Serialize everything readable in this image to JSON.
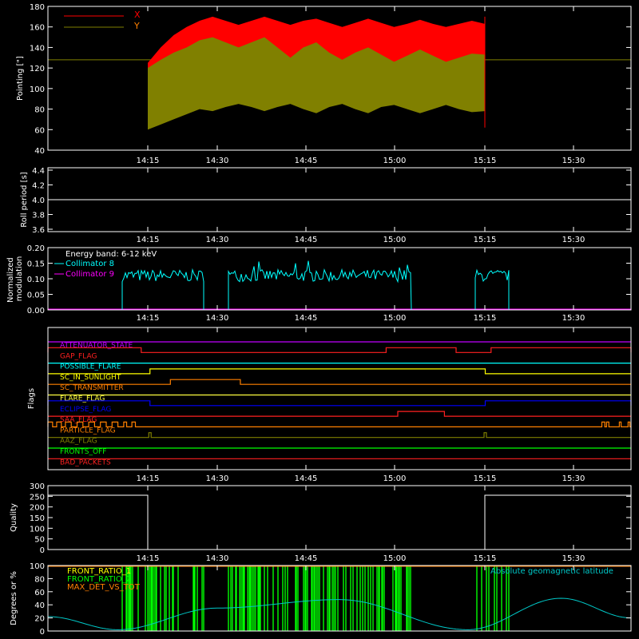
{
  "colors": {
    "background": "#000000",
    "axes": "#ffffff",
    "x_pointing": "#ff0000",
    "y_pointing": "#808000",
    "collimator_8": "#00ffff",
    "collimator_9": "#ff00ff",
    "quality": "#ffffff",
    "front_ratio_1": "#ffff00",
    "front_ratio_2": "#00ff00",
    "max_det_vs_tot": "#ff8000",
    "geomag_latitude": "#00c8c8"
  },
  "time_ticks": [
    "14:15",
    "14:30",
    "14:45",
    "15:00",
    "15:15",
    "15:30"
  ],
  "chart_data": [
    {
      "type": "area",
      "id": "pointing",
      "ylabel": "Pointing [\"]",
      "ylim": [
        40,
        180
      ],
      "yticks": [
        "40",
        "60",
        "80",
        "100",
        "120",
        "140",
        "160",
        "180"
      ],
      "xlim_minutes": [
        0,
        100
      ],
      "legend": [
        "X",
        "Y"
      ],
      "series": [
        {
          "name": "X",
          "x_start": 17.5,
          "x_end": 74.5,
          "upper": [
            125,
            140,
            152,
            160,
            166,
            170,
            166,
            162,
            166,
            170,
            166,
            162,
            166,
            168,
            164,
            160,
            164,
            168,
            164,
            160,
            163,
            167,
            163,
            160,
            163,
            166,
            163
          ],
          "lower": [
            62,
            82,
            95,
            105,
            110,
            112,
            112,
            110,
            112,
            114,
            112,
            110,
            112,
            113,
            111,
            110,
            112,
            113,
            111,
            110,
            112,
            113,
            111,
            110,
            112,
            113,
            112
          ]
        },
        {
          "name": "Y",
          "x_start": 17.5,
          "x_end": 74.5,
          "upper": [
            120,
            128,
            135,
            140,
            147,
            150,
            145,
            140,
            145,
            150,
            140,
            130,
            140,
            145,
            135,
            128,
            135,
            140,
            133,
            126,
            132,
            138,
            132,
            126,
            130,
            134,
            133
          ],
          "lower": [
            60,
            65,
            70,
            75,
            80,
            78,
            82,
            85,
            82,
            78,
            82,
            85,
            80,
            76,
            82,
            85,
            80,
            76,
            82,
            84,
            80,
            76,
            80,
            84,
            80,
            77,
            78
          ]
        }
      ],
      "baseline": 128
    },
    {
      "type": "line",
      "id": "roll_period",
      "ylabel": "Roll period [s]",
      "ylim": [
        3.5,
        4.5
      ],
      "yticks": [
        "3.6",
        "3.8",
        "4.0",
        "4.2",
        "4.4"
      ],
      "series": [
        {
          "name": "",
          "x": [
            0,
            100
          ],
          "values": [
            4.0,
            4.0
          ]
        }
      ]
    },
    {
      "type": "line",
      "id": "modulation",
      "ylabel": "Normalized modulation",
      "ylim": [
        0,
        0.2
      ],
      "yticks": [
        "0.00",
        "0.05",
        "0.10",
        "0.15",
        "0.20"
      ],
      "annotation": "Energy band: 6-12 keV",
      "legend": [
        "Collimator 8",
        "Collimator 9"
      ],
      "segments": [
        [
          16,
          29
        ],
        [
          33,
          58
        ],
        [
          70,
          76
        ]
      ],
      "level": 0.11,
      "noise": 0.012
    },
    {
      "type": "line",
      "id": "flags",
      "ylabel": "Flags",
      "flags": [
        {
          "name": "ATTENUATOR_STATE",
          "color": "#c000ff",
          "high": []
        },
        {
          "name": "GAP_FLAG",
          "color": "#ff2020",
          "high": [
            [
              0,
              16
            ],
            [
              58,
              70
            ],
            [
              76,
              100
            ]
          ]
        },
        {
          "name": "POSSIBLE_FLARE",
          "color": "#00ffff",
          "high": []
        },
        {
          "name": "SC_IN_SUNLIGHT",
          "color": "#ffff00",
          "high": [
            [
              17.5,
              75
            ]
          ]
        },
        {
          "name": "SC_TRANSMITTER",
          "color": "#ff8000",
          "high": [
            [
              21,
              33
            ]
          ]
        },
        {
          "name": "FLARE_FLAG",
          "color": "#ffff40",
          "high": []
        },
        {
          "name": "ECLIPSE_FLAG",
          "color": "#0000ff",
          "high": [
            [
              0,
              17.5
            ],
            [
              75,
              100
            ]
          ]
        },
        {
          "name": "SAA_FLAG",
          "color": "#ff2020",
          "high": [
            [
              60,
              68
            ]
          ]
        },
        {
          "name": "PARTICLE_FLAG",
          "color": "#ff8000",
          "high": [
            [
              0,
              0.8
            ],
            [
              1.5,
              2.3
            ],
            [
              3,
              4
            ],
            [
              5,
              6
            ],
            [
              7,
              8
            ],
            [
              9,
              10
            ],
            [
              11,
              12
            ],
            [
              13,
              13.5
            ],
            [
              14.4,
              15
            ],
            [
              95,
              95.5
            ],
            [
              95.8,
              96.2
            ],
            [
              98,
              98.3
            ],
            [
              99.5,
              99.8
            ]
          ]
        },
        {
          "name": "AAZ_FLAG",
          "color": "#808000",
          "high": [
            [
              17.3,
              17.7
            ],
            [
              74.8,
              75.2
            ]
          ]
        },
        {
          "name": "FRONTS_OFF",
          "color": "#00ff00",
          "high": []
        },
        {
          "name": "BAD_PACKETS",
          "color": "#ff2020",
          "high": []
        }
      ]
    },
    {
      "type": "line",
      "id": "quality",
      "ylabel": "Quality",
      "ylim": [
        0,
        300
      ],
      "yticks": [
        "0",
        "50",
        "100",
        "150",
        "200",
        "250",
        "300"
      ],
      "series": [
        {
          "name": "",
          "x": [
            0,
            17.5,
            17.5,
            75,
            75,
            100
          ],
          "values": [
            255,
            255,
            0,
            0,
            255,
            255
          ]
        }
      ]
    },
    {
      "type": "line",
      "id": "front_ratio",
      "ylabel": "Degrees or %",
      "ylim": [
        0,
        100
      ],
      "yticks": [
        "0",
        "20",
        "40",
        "60",
        "80",
        "100"
      ],
      "legend": [
        "FRONT_RATIO_1",
        "FRONT_RATIO_2",
        "MAX_DET_VS_TOT"
      ],
      "annotation": "Absolute geomagnetic latitude",
      "bar_segments": [
        [
          16,
          29
        ],
        [
          33,
          58
        ],
        [
          70,
          76
        ]
      ],
      "latitude": {
        "x": [
          0,
          12,
          29,
          50,
          72,
          88,
          100
        ],
        "values": [
          22,
          2,
          35,
          48,
          2,
          50,
          20
        ]
      }
    }
  ]
}
